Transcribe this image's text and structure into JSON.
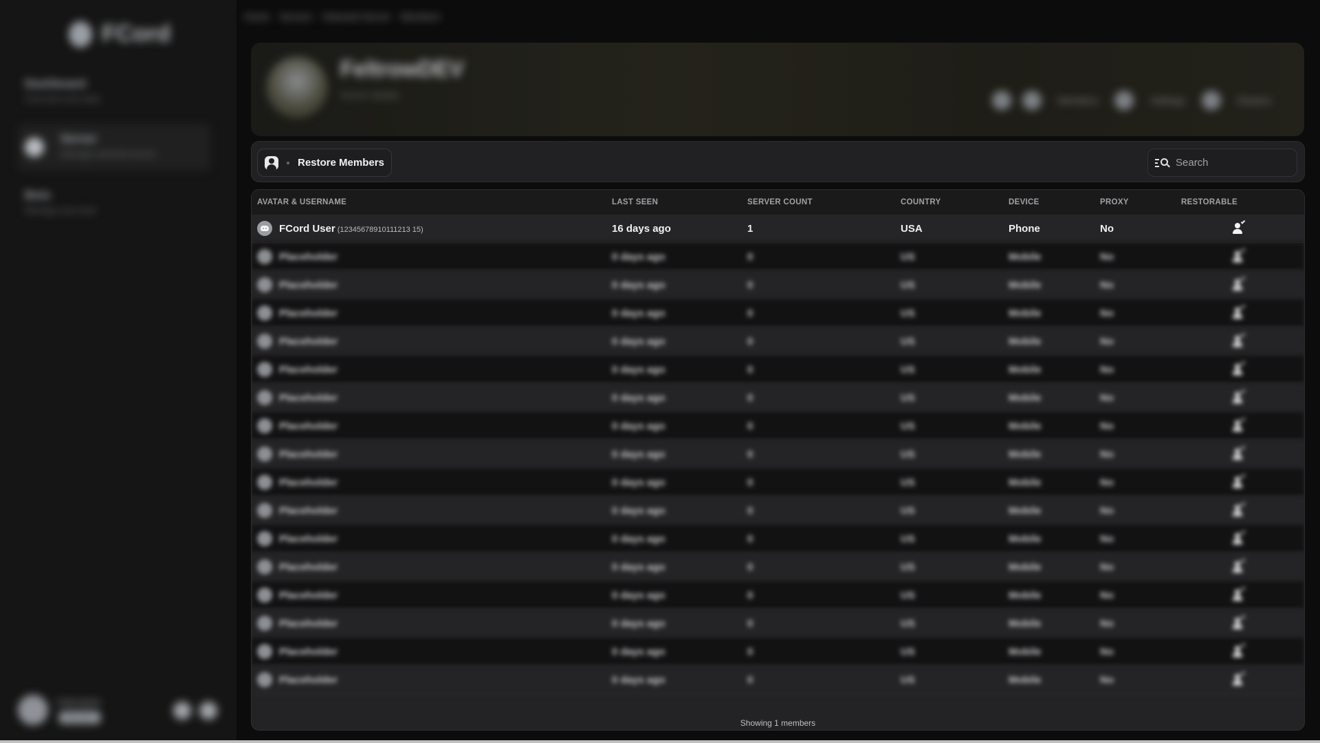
{
  "sidebar": {
    "brand": "FCord",
    "items": [
      {
        "title": "Dashboard",
        "subtitle": "Overview and stats"
      },
      {
        "title": "Server",
        "subtitle": "Manage selected server"
      },
      {
        "title": "Bots",
        "subtitle": "Manage your bots"
      }
    ],
    "user": {
      "name": "Username",
      "tag": "Member"
    }
  },
  "breadcrumb": [
    "Home",
    "Servers",
    "Selected Server",
    "Members"
  ],
  "banner": {
    "server_name": "FeltrowDEV",
    "server_sub": "Server details",
    "actions": [
      "Members",
      "Settings",
      "Restore"
    ]
  },
  "toolbar": {
    "restore_label": "Restore Members",
    "search_placeholder": "Search"
  },
  "table": {
    "columns": [
      "AVATAR & USERNAME",
      "LAST SEEN",
      "SERVER COUNT",
      "COUNTRY",
      "DEVICE",
      "PROXY",
      "RESTORABLE"
    ],
    "rows": [
      {
        "username": "FCord User",
        "user_id": "(12345678910111213 15)",
        "last_seen": "16 days ago",
        "server_count": "1",
        "country": "USA",
        "device": "Phone",
        "proxy": "No",
        "restorable": true
      }
    ],
    "placeholder_row": {
      "username": "Placeholder",
      "last_seen": "0 days ago",
      "server_count": "0",
      "country": "US",
      "device": "Mobile",
      "proxy": "No"
    },
    "placeholder_count": 16,
    "footer": "Showing 1 members"
  },
  "colors": {
    "background": "#0c0c0c",
    "panel": "#232325",
    "row_dark": "#121213",
    "row_light": "#242426",
    "text": "#f0f0f0"
  }
}
